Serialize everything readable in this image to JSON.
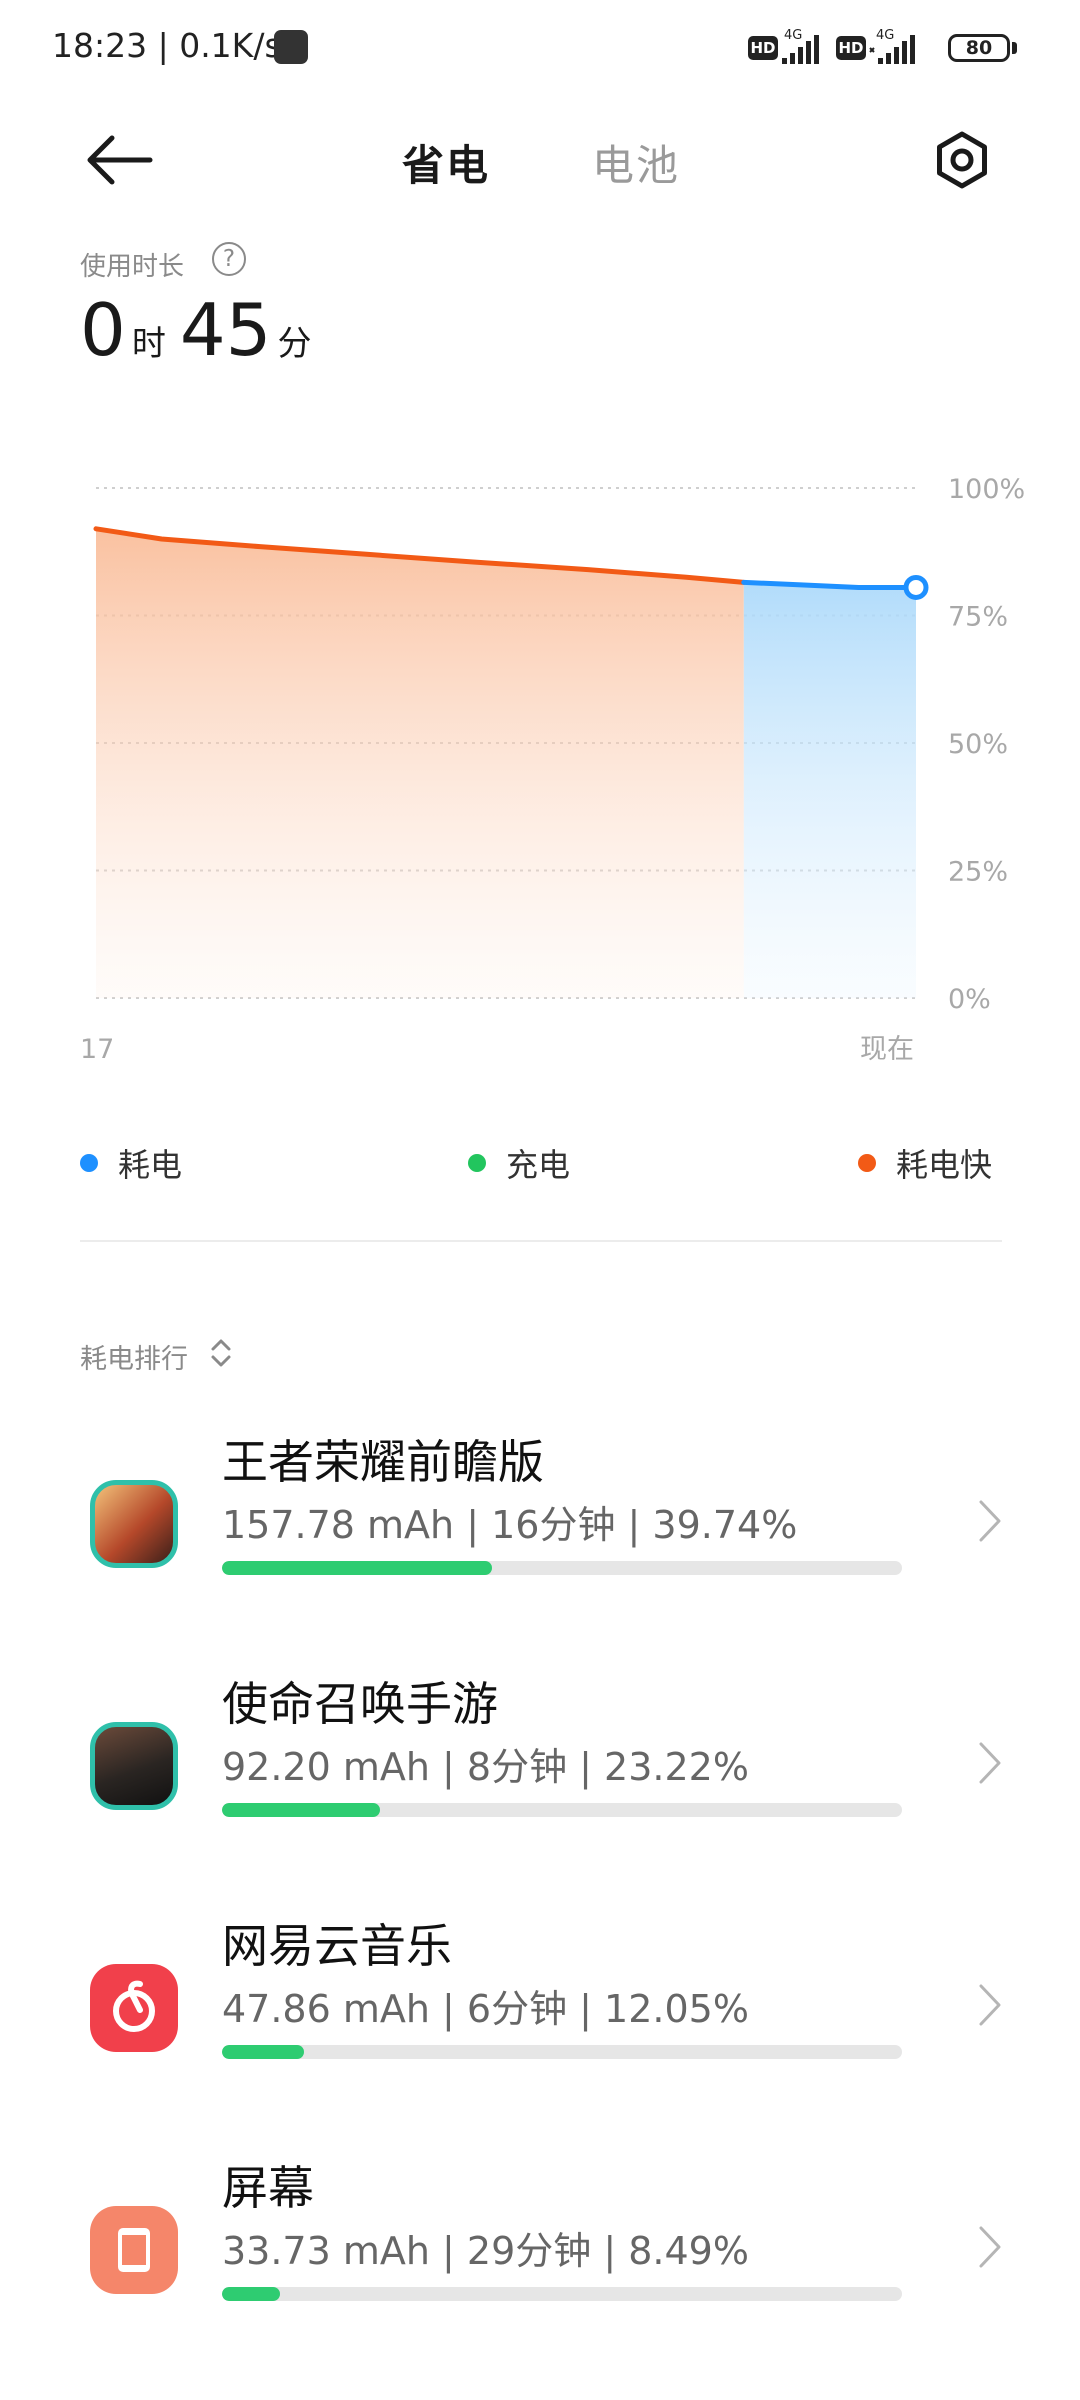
{
  "status_bar": {
    "time_speed": "18:23 | 0.1K/s",
    "hd_label": "HD",
    "network_1": "4G",
    "network_2": "4G",
    "battery_level": "80"
  },
  "header": {
    "tabs": [
      {
        "label": "省电",
        "active": true
      },
      {
        "label": "电池",
        "active": false
      }
    ]
  },
  "usage": {
    "label": "使用时长",
    "hours": "0",
    "hours_unit": "时",
    "minutes": "45",
    "minutes_unit": "分"
  },
  "chart_data": {
    "type": "area",
    "y_tick_labels": [
      "100%",
      "75%",
      "50%",
      "25%",
      "0%"
    ],
    "x_tick_labels": [
      "17",
      "现在"
    ],
    "ylim": [
      0,
      100
    ],
    "x": [
      0,
      8,
      20,
      33,
      46,
      60,
      72,
      79,
      86,
      93,
      100
    ],
    "values": [
      92,
      90,
      88.5,
      87,
      85.5,
      84,
      82.5,
      81.5,
      81,
      80.5,
      80.5
    ],
    "segments": [
      {
        "from_x": 0,
        "to_x": 79,
        "series": "耗电快",
        "color": "#f25a16"
      },
      {
        "from_x": 79,
        "to_x": 100,
        "series": "耗电",
        "color": "#1e90ff"
      }
    ],
    "grid": true
  },
  "legend": [
    {
      "label": "耗电",
      "color": "#1e90ff"
    },
    {
      "label": "充电",
      "color": "#22c55e"
    },
    {
      "label": "耗电快",
      "color": "#f25a16"
    }
  ],
  "ranking": {
    "label": "耗电排行",
    "items": [
      {
        "name": "王者荣耀前瞻版",
        "stats": "157.78 mAh | 16分钟 | 39.74%",
        "percent": 39.74,
        "icon": "game-hero-icon"
      },
      {
        "name": "使命召唤手游",
        "stats": "92.20 mAh | 8分钟 | 23.22%",
        "percent": 23.22,
        "icon": "call-of-duty-icon"
      },
      {
        "name": "网易云音乐",
        "stats": "47.86 mAh | 6分钟 | 12.05%",
        "percent": 12.05,
        "icon": "netease-music-icon"
      },
      {
        "name": "屏幕",
        "stats": "33.73 mAh | 29分钟 | 8.49%",
        "percent": 8.49,
        "icon": "screen-icon"
      }
    ]
  },
  "colors": {
    "accent_green": "#2ecc71",
    "drain_fast": "#f25a16",
    "drain": "#1e90ff"
  }
}
